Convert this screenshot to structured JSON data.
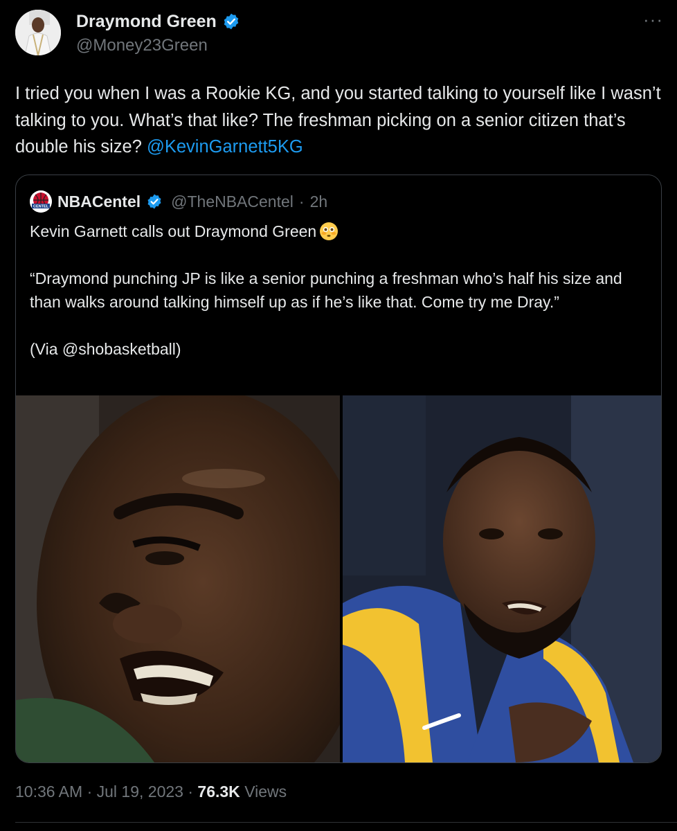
{
  "author": {
    "name": "Draymond Green",
    "handle": "@Money23Green",
    "verified": true,
    "avatar_icon": "avatar-photo"
  },
  "more_label": "···",
  "tweet": {
    "text_main": "I tried you when I was a Rookie KG, and you started talking to yourself like I wasn’t talking to you.  What’s that like? The freshman picking on a senior citizen that’s double his size?",
    "mention": "@KevinGarnett5KG"
  },
  "quoted": {
    "name": "NBACentel",
    "handle": "@TheNBACentel",
    "separator": "·",
    "time": "2h",
    "logo_text": "CENTEL",
    "line1": "Kevin Garnett calls out Draymond Green",
    "emoji_icon": "flushed-face-emoji",
    "line2": "“Draymond punching JP is like a senior punching a freshman who’s half his size and than walks around talking himself up as if he’s like that. Come try me Dray.”",
    "line3": "(Via @shobasketball)"
  },
  "meta": {
    "time": "10:36 AM",
    "sep1": "·",
    "date": "Jul 19, 2023",
    "sep2": "·",
    "views_count": "76.3K",
    "views_label": "Views"
  },
  "colors": {
    "background": "#000000",
    "text": "#e7e9ea",
    "secondary": "#71767b",
    "link": "#1d9bf0",
    "border": "#3b4046"
  }
}
